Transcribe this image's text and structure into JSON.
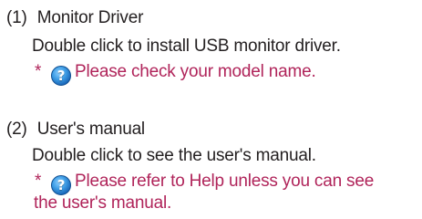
{
  "items": [
    {
      "number": "(1)",
      "title": "Monitor Driver",
      "description": "Double click to install USB monitor driver.",
      "note_marker": "*",
      "note_icon": "help-question-icon",
      "note_line1": "Please check your model name.",
      "note_line2": ""
    },
    {
      "number": "(2)",
      "title": "User's manual",
      "description": "Double click to see the user's manual.",
      "note_marker": "*",
      "note_icon": "help-question-icon",
      "note_line1": "Please refer to Help unless you can see",
      "note_line2": "the user's manual."
    }
  ],
  "colors": {
    "text": "#231f20",
    "note": "#b0245a",
    "icon": "#2f84d3"
  }
}
